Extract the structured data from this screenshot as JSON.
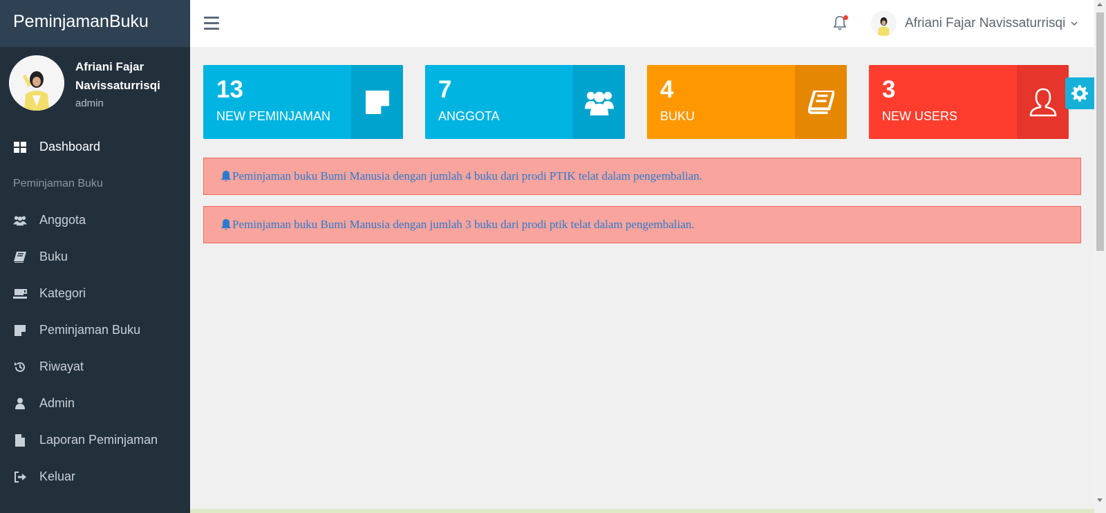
{
  "brand": "PeminjamanBuku",
  "profile": {
    "name": "Afriani Fajar Navissaturrisqi",
    "role": "admin"
  },
  "nav": {
    "dashboard": "Dashboard",
    "section_header": "Peminjaman Buku",
    "items": [
      "Anggota",
      "Buku",
      "Kategori",
      "Peminjaman Buku",
      "Riwayat",
      "Admin",
      "Laporan Peminjaman",
      "Keluar"
    ]
  },
  "topbar": {
    "user_name": "Afriani Fajar Navissaturrisqi"
  },
  "cards": [
    {
      "value": "13",
      "label": "NEW PEMINJAMAN",
      "color": "#00b4e2",
      "side_color": "#00a3cd",
      "icon": "sticky-note-icon"
    },
    {
      "value": "7",
      "label": "ANGGOTA",
      "color": "#00b4e2",
      "side_color": "#00a3cd",
      "icon": "users-icon"
    },
    {
      "value": "4",
      "label": "BUKU",
      "color": "#ff9800",
      "side_color": "#e68700",
      "icon": "book-icon"
    },
    {
      "value": "3",
      "label": "NEW USERS",
      "color": "#ff3d2e",
      "side_color": "#e6352a",
      "icon": "user-outline-icon"
    }
  ],
  "alerts": [
    "Peminjaman buku Bumi Manusia dengan jumlah 4 buku dari prodi PTIK telat dalam pengembalian.",
    "Peminjaman buku Bumi Manusia dengan jumlah 3 buku dari prodi ptik telat dalam pengembalian."
  ]
}
